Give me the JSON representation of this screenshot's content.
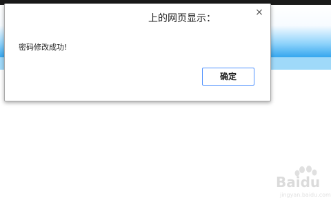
{
  "dialog": {
    "title": "上的网页显示：",
    "message": "密码修改成功!",
    "ok_label": "确定",
    "close_glyph": "×"
  },
  "watermark": {
    "logo_text": "Baidu",
    "sub_text": "jingyan.baidu.com"
  },
  "colors": {
    "header_blue": "#35a6ee",
    "band_blue": "#9fd9f9",
    "button_border": "#4d90fe"
  }
}
